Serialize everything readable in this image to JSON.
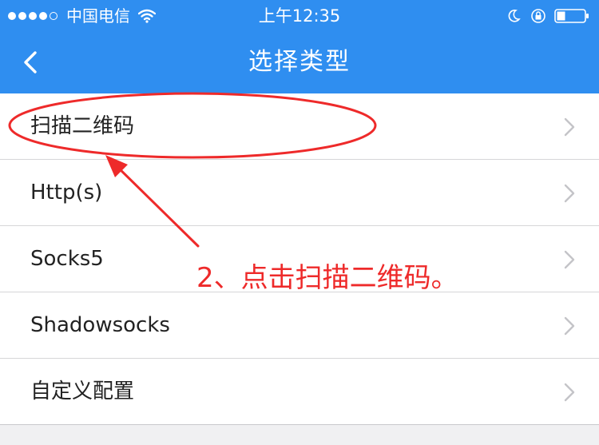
{
  "status_bar": {
    "carrier": "中国电信",
    "time": "上午12:35",
    "signal_bars_filled": 4,
    "signal_bars_total": 5,
    "icons": [
      "wifi-icon",
      "moon-icon",
      "orientation-lock-icon",
      "battery-icon"
    ]
  },
  "nav": {
    "title": "选择类型",
    "back_icon": "chevron-left-icon"
  },
  "list": {
    "items": [
      {
        "label": "扫描二维码"
      },
      {
        "label": "Http(s)"
      },
      {
        "label": "Socks5"
      },
      {
        "label": "Shadowsocks"
      },
      {
        "label": "自定义配置"
      }
    ],
    "chevron_icon": "chevron-right-icon"
  },
  "annotation": {
    "text": "2、点击扫描二维码。",
    "color": "#ee2a2a"
  },
  "colors": {
    "accent": "#2f8ef0",
    "background": "#f0f0f2"
  }
}
